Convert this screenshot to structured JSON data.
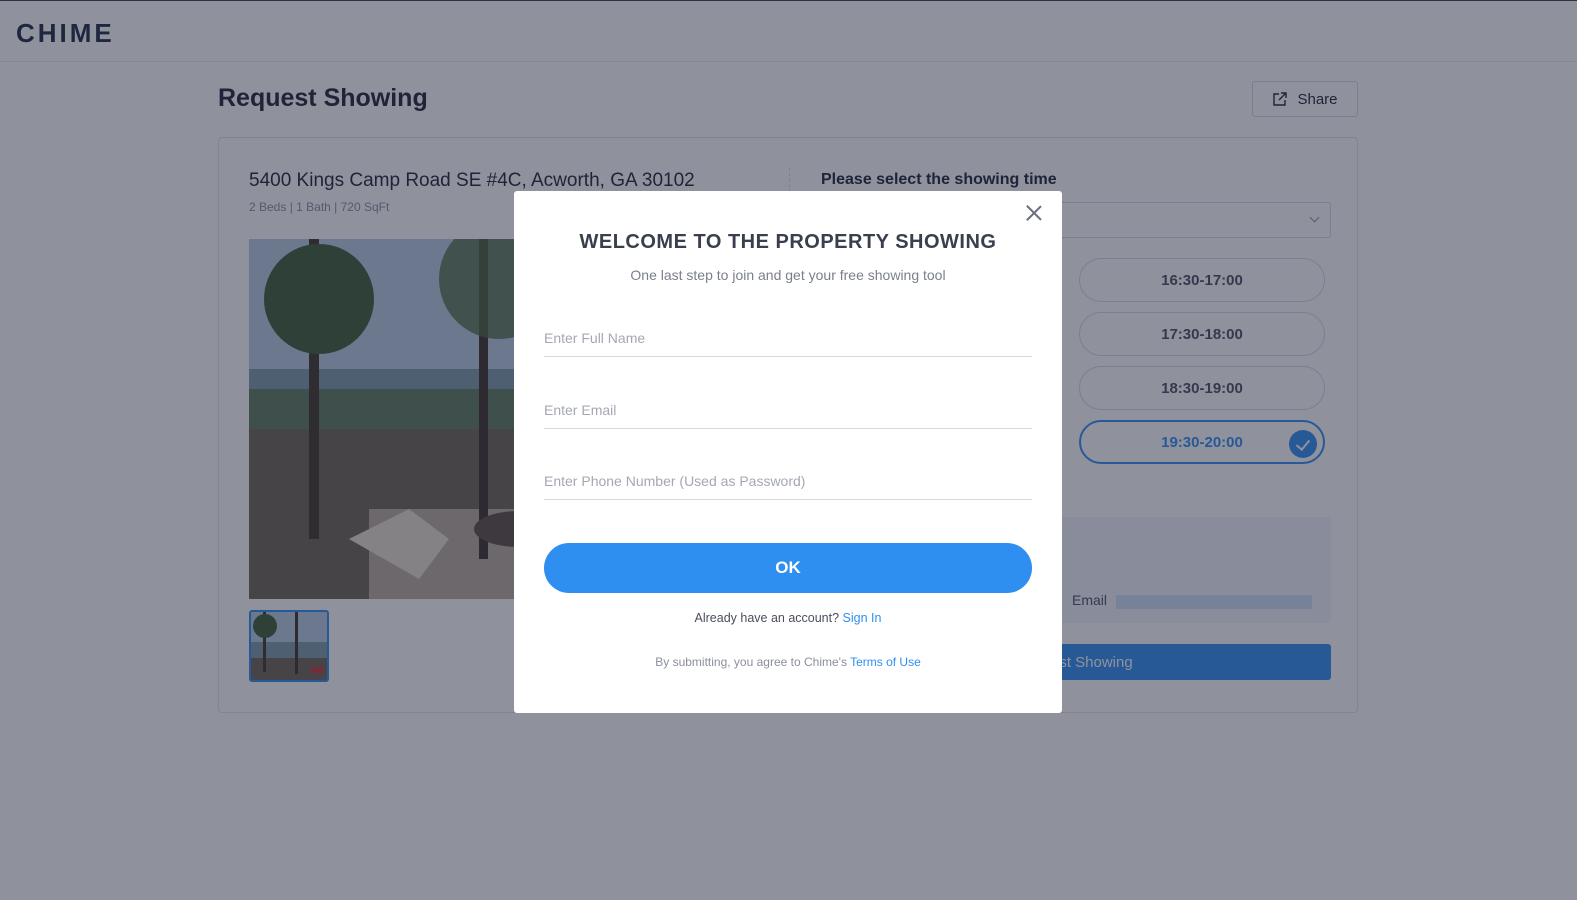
{
  "header": {
    "logo_text": "CHIME"
  },
  "page": {
    "title": "Request Showing",
    "share_label": "Share"
  },
  "property": {
    "address": "5400 Kings Camp Road SE #4C, Acworth, GA 30102",
    "meta": "2 Beds | 1 Bath | 720 SqFt"
  },
  "showing": {
    "title": "Please select the showing time",
    "slots": [
      {
        "time": "16:30-17:00",
        "selected": false
      },
      {
        "time": "17:30-18:00",
        "selected": false
      },
      {
        "time": "18:30-19:00",
        "selected": false
      },
      {
        "time": "19:30-20:00",
        "selected": true
      }
    ],
    "email_label": "Email",
    "request_button_partial": "st Showing"
  },
  "modal": {
    "title": "WELCOME TO THE PROPERTY SHOWING",
    "subtitle": "One last step to join and get your free showing tool",
    "full_name_placeholder": "Enter Full Name",
    "email_placeholder": "Enter Email",
    "phone_placeholder": "Enter Phone Number (Used as Password)",
    "ok_label": "OK",
    "account_prompt": "Already have an account?",
    "sign_in_label": "Sign In",
    "terms_prefix": "By submitting, you agree to Chime's",
    "terms_link": "Terms of Use"
  },
  "colors": {
    "accent": "#2f8ff0",
    "overlay": "rgba(32,36,60,0.5)"
  }
}
